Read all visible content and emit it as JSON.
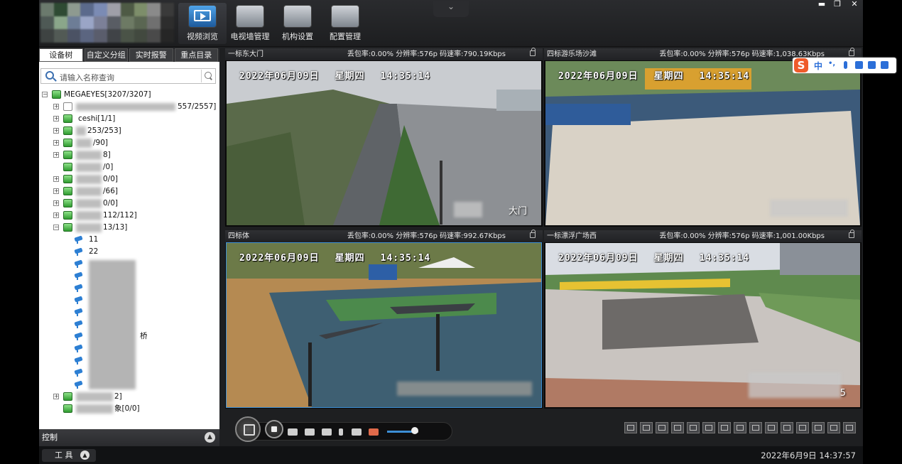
{
  "nav": {
    "items": [
      {
        "label": "视频浏览",
        "icon": "monitor-play-icon",
        "active": true
      },
      {
        "label": "电视墙管理",
        "icon": "tv-wall-icon",
        "active": false
      },
      {
        "label": "机构设置",
        "icon": "organization-icon",
        "active": false
      },
      {
        "label": "配置管理",
        "icon": "tools-icon",
        "active": false
      }
    ],
    "collapse_glyph": "⌄"
  },
  "window_controls": {
    "minimize": "▬",
    "restore": "❐",
    "close": "✕"
  },
  "sidebar": {
    "tabs": [
      {
        "label": "设备树",
        "active": true
      },
      {
        "label": "自定义分组",
        "active": false
      },
      {
        "label": "实时报警",
        "active": false
      },
      {
        "label": "重点目录",
        "active": false
      }
    ],
    "search_placeholder": "请输入名称查询",
    "tree": {
      "root": "MEGAEYES[3207/3207]",
      "nodes": [
        "557/2557]",
        "ceshi[1/1]",
        "253/253]",
        "/90]",
        "8]",
        "/0]",
        "0/0]",
        "/66]",
        "0/0]",
        "112/112]",
        "13/13]",
        "11",
        "22",
        "桥",
        "2]",
        "象[0/0]"
      ]
    },
    "control_label": "控制"
  },
  "panes": [
    {
      "title": "一标东大门",
      "stats": "丢包率:0.00% 分辨率:576p 码速率:790.19Kbps",
      "osd_date": "2022年06月09日",
      "osd_weekday": "星期四",
      "osd_time": "14:35:14",
      "osd_caption": "大门"
    },
    {
      "title": "四标游乐场沙滩",
      "stats": "丢包率:0.00% 分辨率:576p 码速率:1,038.63Kbps",
      "osd_date": "2022年06月09日",
      "osd_weekday": "星期四",
      "osd_time": "14:35:14",
      "osd_caption": ""
    },
    {
      "title": "四标体",
      "stats": "丢包率:0.00% 分辨率:576p 码速率:992.67Kbps",
      "osd_date": "2022年06月09日",
      "osd_weekday": "星期四",
      "osd_time": "14:35:14",
      "osd_caption": ""
    },
    {
      "title": "一标漂浮广场西",
      "stats": "丢包率:0.00% 分辨率:576p 码速率:1,001.00Kbps",
      "osd_date": "2022年06月09日",
      "osd_weekday": "星期四",
      "osd_time": "14:35:14",
      "osd_caption": "5"
    }
  ],
  "footer": {
    "tools_label": "工 具",
    "datetime": "2022年6月9日    14:37:57"
  },
  "ime": {
    "logo": "S",
    "mode": "中",
    "symbols": "•,"
  },
  "colors": {
    "accent": "#3d8fd6",
    "tree_icon": "#2f9b30",
    "camera_icon": "#2d7fd3"
  }
}
